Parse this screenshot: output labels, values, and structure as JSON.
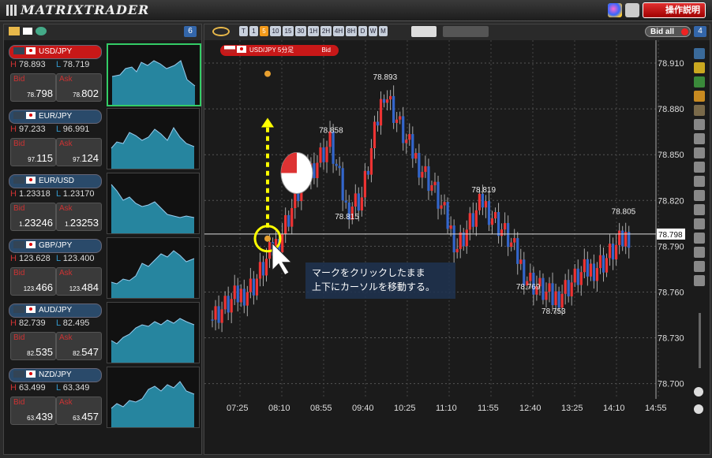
{
  "app": {
    "title": "MATRIXTRADER",
    "help_label": "操作説明"
  },
  "left_panel": {
    "count": "6"
  },
  "pairs": [
    {
      "name": "USD/JPY",
      "high": "78.893",
      "low": "78.719",
      "bid_prefix": "78.",
      "bid": "798",
      "ask_prefix": "78.",
      "ask": "802",
      "selected": true
    },
    {
      "name": "EUR/JPY",
      "high": "97.233",
      "low": "96.991",
      "bid_prefix": "97.",
      "bid": "115",
      "ask_prefix": "97.",
      "ask": "124"
    },
    {
      "name": "EUR/USD",
      "high": "1.23318",
      "low": "1.23170",
      "bid_prefix": "1.",
      "bid": "23246",
      "ask_prefix": "1.",
      "ask": "23253"
    },
    {
      "name": "GBP/JPY",
      "high": "123.628",
      "low": "123.400",
      "bid_prefix": "123.",
      "bid": "466",
      "ask_prefix": "123.",
      "ask": "484"
    },
    {
      "name": "AUD/JPY",
      "high": "82.739",
      "low": "82.495",
      "bid_prefix": "82.",
      "bid": "535",
      "ask_prefix": "82.",
      "ask": "547"
    },
    {
      "name": "NZD/JPY",
      "high": "63.499",
      "low": "63.349",
      "bid_prefix": "63.",
      "bid": "439",
      "ask_prefix": "63.",
      "ask": "457"
    }
  ],
  "labels": {
    "bid": "Bid",
    "ask": "Ask",
    "high_key": "H",
    "low_key": "L"
  },
  "toolbar": {
    "timeframes": [
      "T",
      "1",
      "5",
      "10",
      "15",
      "30",
      "1H",
      "2H",
      "4H",
      "8H",
      "D",
      "W",
      "M"
    ],
    "active": "5",
    "bid_all": "Bid all",
    "count": "4"
  },
  "chart_header": {
    "symbol": "USD/JPY 5分足",
    "side": "Bid"
  },
  "chart_data": {
    "type": "candlestick",
    "y_ticks": [
      "78.910",
      "78.880",
      "78.850",
      "78.820",
      "78.790",
      "78.760",
      "78.730",
      "78.700"
    ],
    "x_ticks": [
      "07:25",
      "08:10",
      "08:55",
      "09:40",
      "10:25",
      "11:10",
      "11:55",
      "12:40",
      "13:25",
      "14:10",
      "14:55"
    ],
    "annotations": [
      "78.893",
      "78.858",
      "78.815",
      "78.819",
      "78.769",
      "78.753",
      "78.805"
    ],
    "current_price": "78.798"
  },
  "instruction": {
    "line1": "マークをクリックしたまま",
    "line2": "上下にカーソルを移動する。"
  }
}
